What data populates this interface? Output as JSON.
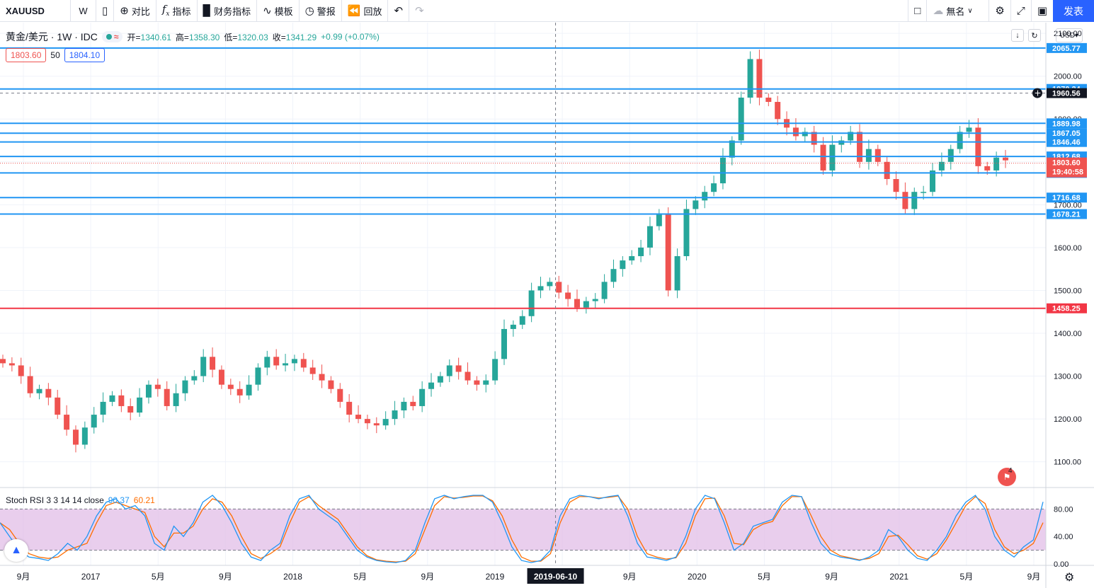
{
  "toolbar": {
    "symbol": "XAUUSD",
    "interval": "W",
    "compare": "对比",
    "indicators": "指标",
    "financials": "财务指标",
    "templates": "模板",
    "alert": "警报",
    "replay": "回放",
    "layout_name": "無名",
    "publish": "发表"
  },
  "legend": {
    "title": "黄金/美元 · 1W · IDC",
    "open_label": "开",
    "open": "1340.61",
    "high_label": "高",
    "high": "1358.30",
    "low_label": "低",
    "low": "1320.03",
    "close_label": "收",
    "close": "1341.29",
    "change": "+0.99 (+0.07%)"
  },
  "trade": {
    "sell": "1803.60",
    "spread": "50",
    "buy": "1804.10"
  },
  "currency": "USD",
  "rsi_legend": {
    "name": "Stoch RSI 3 3 14 14 close",
    "k": "90.37",
    "d": "60.21"
  },
  "crosshair_date": "2019-06-10",
  "countdown": "19:40:58",
  "calendar_badge": "4",
  "colors": {
    "up": "#26a69a",
    "down": "#ef5350",
    "level": "#2196f3",
    "support": "#f23645",
    "accent": "#2962ff"
  },
  "chart_data": {
    "type": "candlestick",
    "y_range": [
      1040,
      2125
    ],
    "y_ticks": [
      "2100.00",
      "2000.00",
      "1900.00",
      "1800.00",
      "1700.00",
      "1600.00",
      "1500.00",
      "1400.00",
      "1300.00",
      "1200.00",
      "1100.00"
    ],
    "x_ticks": [
      "9月",
      "2017",
      "5月",
      "9月",
      "2018",
      "5月",
      "9月",
      "2019",
      "5月",
      "9月",
      "2020",
      "5月",
      "9月",
      "2021",
      "5月",
      "9月"
    ],
    "horizontal_levels": [
      {
        "price": 2065.77,
        "label": "2065.77",
        "color": "#2196f3"
      },
      {
        "price": 1970.24,
        "label": "1970.24",
        "color": "#2196f3"
      },
      {
        "price": 1889.98,
        "label": "1889.98",
        "color": "#2196f3"
      },
      {
        "price": 1867.05,
        "label": "1867.05",
        "color": "#2196f3"
      },
      {
        "price": 1846.46,
        "label": "1846.46",
        "color": "#2196f3"
      },
      {
        "price": 1812.68,
        "label": "1812.68",
        "color": "#2196f3"
      },
      {
        "price": 1774.36,
        "label": "1774.36",
        "color": "#2196f3"
      },
      {
        "price": 1716.68,
        "label": "1716.68",
        "color": "#2196f3"
      },
      {
        "price": 1678.21,
        "label": "1678.21",
        "color": "#2196f3"
      },
      {
        "price": 1458.25,
        "label": "1458.25",
        "color": "#f23645"
      }
    ],
    "crosshair_price": "1960.56",
    "last_price": "1803.60",
    "close_path": [
      1330,
      1325,
      1300,
      1260,
      1270,
      1250,
      1210,
      1175,
      1140,
      1180,
      1210,
      1240,
      1255,
      1230,
      1215,
      1250,
      1280,
      1270,
      1230,
      1260,
      1290,
      1300,
      1345,
      1315,
      1280,
      1270,
      1255,
      1280,
      1320,
      1345,
      1325,
      1330,
      1340,
      1320,
      1305,
      1290,
      1270,
      1240,
      1210,
      1200,
      1190,
      1185,
      1200,
      1220,
      1240,
      1230,
      1270,
      1285,
      1300,
      1325,
      1310,
      1290,
      1280,
      1290,
      1340,
      1410,
      1420,
      1440,
      1500,
      1510,
      1520,
      1495,
      1480,
      1460,
      1475,
      1480,
      1520,
      1550,
      1570,
      1580,
      1600,
      1650,
      1680,
      1500,
      1580,
      1690,
      1710,
      1730,
      1750,
      1810,
      1850,
      1950,
      2040,
      1950,
      1940,
      1900,
      1880,
      1860,
      1870,
      1840,
      1780,
      1840,
      1850,
      1870,
      1800,
      1830,
      1800,
      1760,
      1730,
      1690,
      1730,
      1730,
      1780,
      1800,
      1830,
      1870,
      1880,
      1790,
      1780,
      1810,
      1803.6
    ],
    "stoch_rsi": {
      "y_ticks": [
        "80.00",
        "40.00",
        "0.00"
      ],
      "k": [
        60,
        40,
        20,
        10,
        8,
        5,
        15,
        30,
        20,
        40,
        70,
        90,
        95,
        80,
        85,
        70,
        30,
        20,
        55,
        40,
        60,
        90,
        100,
        85,
        60,
        30,
        10,
        5,
        20,
        30,
        70,
        95,
        100,
        80,
        70,
        60,
        40,
        20,
        10,
        5,
        3,
        2,
        5,
        20,
        60,
        95,
        100,
        95,
        98,
        100,
        100,
        90,
        60,
        25,
        5,
        2,
        5,
        20,
        70,
        95,
        100,
        98,
        95,
        98,
        100,
        70,
        30,
        10,
        8,
        5,
        10,
        40,
        80,
        100,
        95,
        60,
        20,
        30,
        55,
        60,
        65,
        90,
        100,
        98,
        60,
        30,
        15,
        10,
        8,
        5,
        10,
        20,
        50,
        40,
        20,
        8,
        5,
        20,
        40,
        70,
        90,
        100,
        80,
        40,
        20,
        10,
        25,
        35,
        90.37
      ],
      "d": [
        60,
        50,
        30,
        15,
        10,
        8,
        10,
        20,
        25,
        30,
        60,
        85,
        90,
        85,
        80,
        75,
        40,
        25,
        45,
        45,
        55,
        80,
        95,
        90,
        70,
        40,
        15,
        8,
        15,
        25,
        60,
        90,
        98,
        85,
        75,
        65,
        45,
        25,
        12,
        6,
        4,
        3,
        4,
        15,
        50,
        85,
        98,
        96,
        97,
        99,
        99,
        92,
        70,
        35,
        10,
        4,
        4,
        15,
        60,
        90,
        98,
        98,
        96,
        97,
        99,
        80,
        40,
        15,
        10,
        7,
        9,
        30,
        70,
        95,
        96,
        70,
        30,
        28,
        50,
        58,
        62,
        85,
        98,
        98,
        70,
        40,
        20,
        12,
        9,
        6,
        8,
        15,
        40,
        42,
        28,
        12,
        7,
        15,
        35,
        60,
        85,
        98,
        88,
        50,
        25,
        15,
        20,
        30,
        60.21
      ]
    }
  }
}
